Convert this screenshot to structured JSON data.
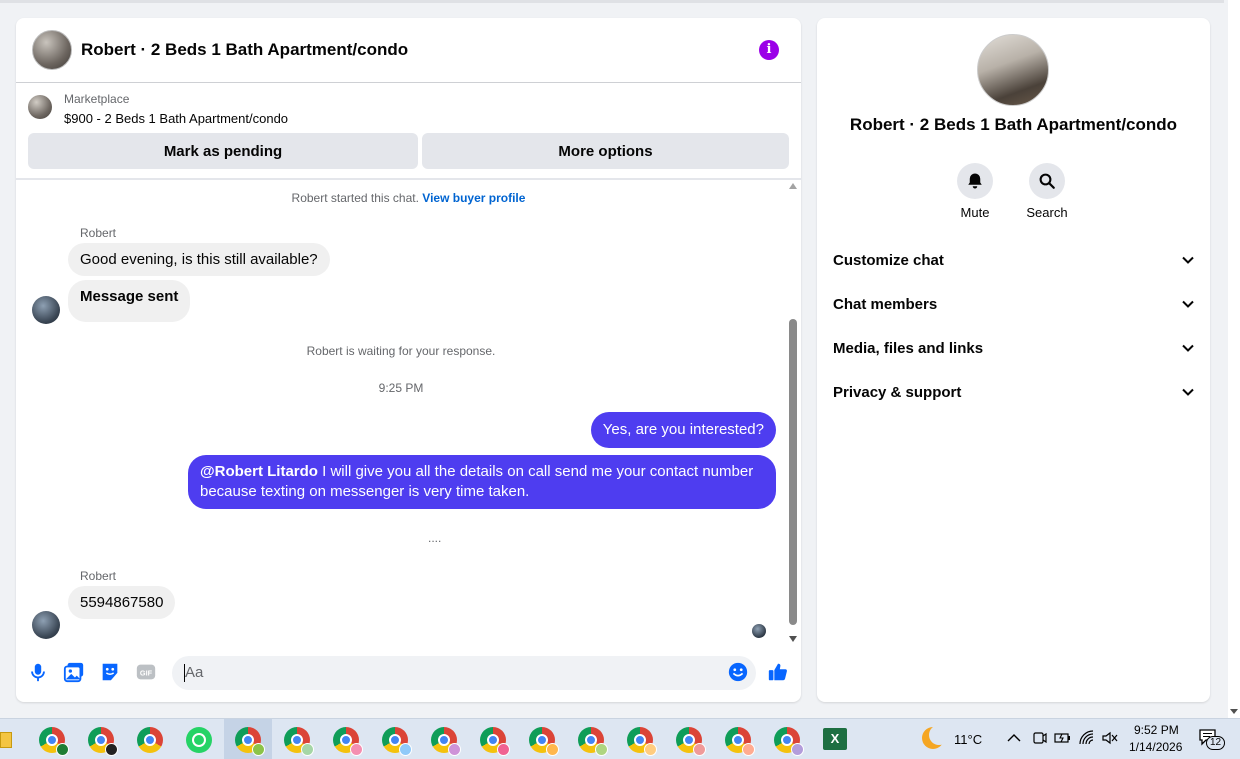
{
  "chat": {
    "title": "Robert · 2 Beds 1 Bath Apartment/condo",
    "marketplace_label": "Marketplace",
    "listing": "$900 - 2 Beds 1 Bath Apartment/condo",
    "buttons": {
      "pending": "Mark as pending",
      "more": "More options"
    },
    "started_text": "Robert started this chat.",
    "buyer_profile_link": "View buyer profile",
    "messages": {
      "sender1": "Robert",
      "in1": "Good evening, is this still available?",
      "in2": "Message sent",
      "waiting": "Robert is waiting for your response.",
      "time": "9:25 PM",
      "out1": "Yes, are you interested?",
      "out2_mention": "@Robert Litardo",
      "out2_line1": " I will give you all the details on call send me your contact number",
      "out2_line2": "because texting on messenger is very time taken.",
      "typing": "....",
      "sender2": "Robert",
      "in3": "5594867580"
    },
    "composer": {
      "placeholder": "Aa"
    }
  },
  "side": {
    "name": "Robert · 2 Beds 1 Bath Apartment/condo",
    "mute_label": "Mute",
    "search_label": "Search",
    "sections": [
      "Customize chat",
      "Chat members",
      "Media, files and links",
      "Privacy & support"
    ]
  },
  "taskbar": {
    "temperature": "11°C",
    "time": "9:52 PM",
    "date": "1/14/2026",
    "notifications": "12"
  },
  "colors": {
    "accent": "#4e3df0",
    "info": "#9b00e8",
    "link": "#0064d1",
    "icon_blue": "#0866ff"
  }
}
